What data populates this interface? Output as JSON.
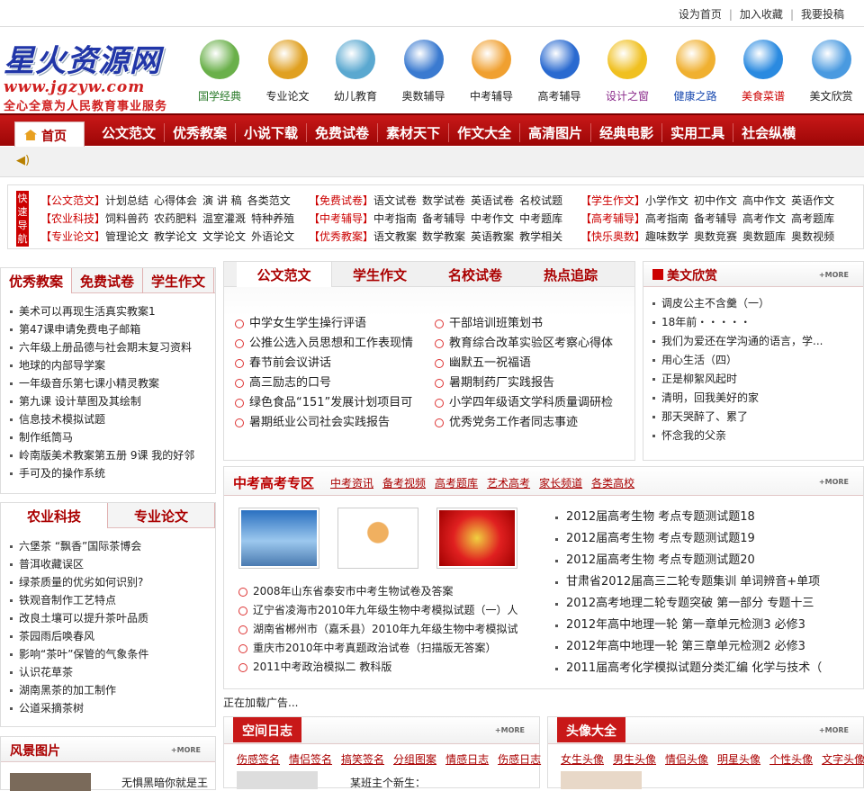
{
  "toplinks": [
    "设为首页",
    "加入收藏",
    "我要投稿"
  ],
  "logo": {
    "title": "星火资源网",
    "url_text": "www.jgzyw.com",
    "slogan": "全心全意为人民教育事业服务"
  },
  "categories": [
    {
      "label": "国学经典",
      "color": "#2a7a2a",
      "icon": "globe-icon"
    },
    {
      "label": "专业论文",
      "color": "#222",
      "icon": "people-icon"
    },
    {
      "label": "幼儿教育",
      "color": "#222",
      "icon": "baby-icon"
    },
    {
      "label": "奥数辅导",
      "color": "#222",
      "icon": "book-icon"
    },
    {
      "label": "中考辅导",
      "color": "#222",
      "icon": "pencil-icon"
    },
    {
      "label": "高考辅导",
      "color": "#222",
      "icon": "grad-cap-icon"
    },
    {
      "label": "设计之窗",
      "color": "#8a2a8a",
      "icon": "design-icon"
    },
    {
      "label": "健康之路",
      "color": "#1a4ab0",
      "icon": "clock-icon"
    },
    {
      "label": "美食菜谱",
      "color": "#c00",
      "icon": "food-icon"
    },
    {
      "label": "美文欣赏",
      "color": "#222",
      "icon": "sparkle-icon"
    }
  ],
  "nav": {
    "home": "首页",
    "items": [
      "公文范文",
      "优秀教案",
      "小说下载",
      "免费试卷",
      "素材天下",
      "作文大全",
      "高清图片",
      "经典电影",
      "实用工具",
      "社会纵横"
    ]
  },
  "quicknav": {
    "label": "快速导航",
    "rows": [
      [
        {
          "h": "【公文范文】",
          "links": [
            "计划总结",
            "心得体会",
            "演 讲 稿",
            "各类范文"
          ]
        },
        {
          "h": "【免费试卷】",
          "links": [
            "语文试卷",
            "数学试卷",
            "英语试卷",
            "名校试题"
          ]
        },
        {
          "h": "【学生作文】",
          "links": [
            "小学作文",
            "初中作文",
            "高中作文",
            "英语作文"
          ]
        }
      ],
      [
        {
          "h": "【农业科技】",
          "links": [
            "饲料兽药",
            "农药肥料",
            "温室灌溉",
            "特种养殖"
          ]
        },
        {
          "h": "【中考辅导】",
          "links": [
            "中考指南",
            "备考辅导",
            "中考作文",
            "中考题库"
          ]
        },
        {
          "h": "【高考辅导】",
          "links": [
            "高考指南",
            "备考辅导",
            "高考作文",
            "高考题库"
          ]
        }
      ],
      [
        {
          "h": "【专业论文】",
          "links": [
            "管理论文",
            "教学论文",
            "文学论文",
            "外语论文"
          ]
        },
        {
          "h": "【优秀教案】",
          "links": [
            "语文教案",
            "数学教案",
            "英语教案",
            "教学相关"
          ]
        },
        {
          "h": "【快乐奥数】",
          "links": [
            "趣味数学",
            "奥数竞赛",
            "奥数题库",
            "奥数视频"
          ]
        }
      ]
    ]
  },
  "left1": {
    "tabs": [
      "优秀教案",
      "免费试卷",
      "学生作文"
    ],
    "items": [
      "美术可以再现生活真实教案1",
      "第47课申请免费电子邮箱",
      "六年级上册品德与社会期末复习资料",
      "地球的内部导学案",
      "一年级音乐第七课小精灵教案",
      "第九课 设计草图及其绘制",
      "信息技术模拟试题",
      "制作纸筒马",
      "岭南版美术教案第五册 9课 我的好邻",
      "手可及的操作系统"
    ]
  },
  "left2": {
    "tabs": [
      "农业科技",
      "专业论文"
    ],
    "items": [
      "六堡茶 “飘香”国际茶博会",
      "普洱收藏误区",
      "绿茶质量的优劣如何识别?",
      "铁观音制作工艺特点",
      "改良土壤可以提升茶叶品质",
      "茶园雨后唤春风",
      "影响“茶叶”保管的气象条件",
      "认识花草茶",
      "湖南黑茶的加工制作",
      "公道采摘茶树"
    ]
  },
  "left3": {
    "title": "风景图片",
    "more": "+MORE",
    "caption": "无惧黑暗你就是王"
  },
  "center1": {
    "tabs": [
      "公文范文",
      "学生作文",
      "名校试卷",
      "热点追踪"
    ],
    "col1": [
      "中学女生学生操行评语",
      "公推公选入员思想和工作表现情",
      "春节前会议讲话",
      "高三励志的口号",
      "绿色食品“151”发展计划项目可",
      "暑期纸业公司社会实践报告"
    ],
    "col2": [
      "干部培训班策划书",
      "教育综合改革实验区考察心得体",
      "幽默五一祝福语",
      "暑期制药厂实践报告",
      "小学四年级语文学科质量调研检",
      "优秀党务工作者同志事迹"
    ]
  },
  "right1": {
    "title": "美文欣赏",
    "more": "+MORE",
    "items": [
      "调皮公主不含羹（一）",
      "18年前・・・・・",
      "我们为爱还在学沟通的语言，学...",
      "用心生活（四）",
      "正是柳絮风起时",
      "清明，回我美好的家",
      "那天哭醉了、累了",
      "怀念我的父亲"
    ]
  },
  "exam": {
    "title": "中考高考专区",
    "more": "+MORE",
    "links": [
      "中考资讯",
      "备考视频",
      "高考题库",
      "艺术高考",
      "家长频道",
      "各类高校"
    ],
    "thumbs": [
      "thumb-sky",
      "thumb-cartoon",
      "thumb-poster"
    ],
    "left_items": [
      "2008年山东省泰安市中考生物试卷及答案",
      "辽宁省凌海市2010年九年级生物中考模拟试题（一）人",
      "湖南省郴州市（嘉禾县）2010年九年级生物中考模拟试",
      "重庆市2010年中考真题政治试卷（扫描版无答案）",
      "2011中考政治模拟二 教科版"
    ],
    "right_items": [
      "2012届高考生物 考点专题测试题18",
      "2012届高考生物 考点专题测试题19",
      "2012届高考生物 考点专题测试题20",
      "甘肃省2012届高三二轮专题集训 单词辨音+单项",
      "2012高考地理二轮专题突破 第一部分 专题十三",
      "2012年高中地理一轮 第一章单元检测3 必修3",
      "2012年高中地理一轮 第三章单元检测2 必修3",
      "2011届高考化学模拟试题分类汇编 化学与技术（"
    ]
  },
  "ad": "正在加载广告...",
  "blog": {
    "title": "空间日志",
    "more": "+MORE",
    "links": [
      "伤感签名",
      "情侣签名",
      "搞笑签名",
      "分组图案",
      "情感日志",
      "伤感日志"
    ],
    "first": "某班主个新生："
  },
  "avatar": {
    "title": "头像大全",
    "more": "+MORE",
    "links": [
      "女生头像",
      "男生头像",
      "情侣头像",
      "明星头像",
      "个性头像",
      "文字头像"
    ]
  }
}
